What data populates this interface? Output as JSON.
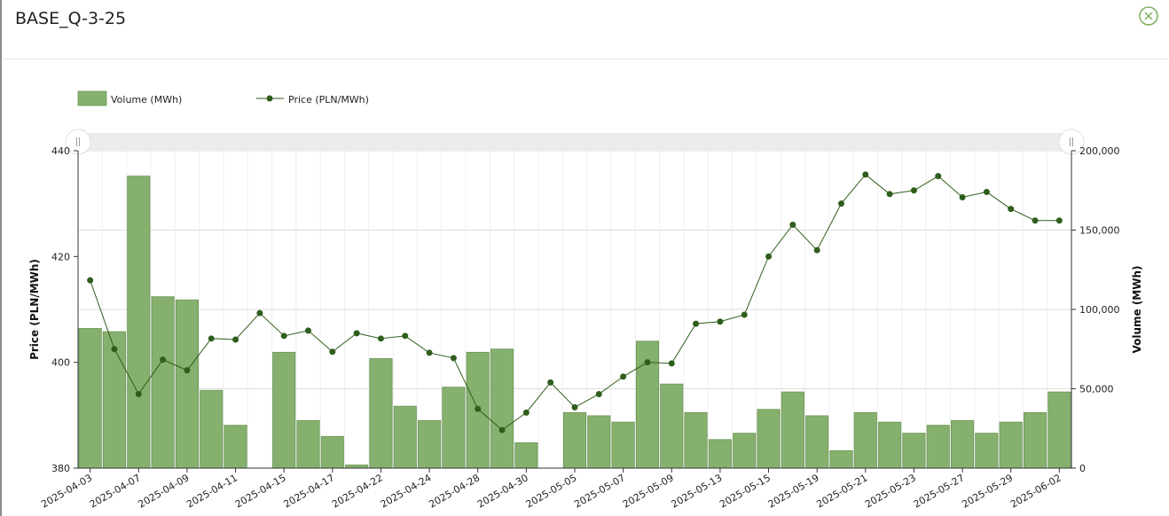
{
  "window": {
    "title": "BASE_Q-3-25",
    "close_icon": "close-circle-icon"
  },
  "colors": {
    "bar_fill": "#86b06e",
    "bar_stroke": "#6a9654",
    "line": "#2f5e1c",
    "point": "#2f5e1c",
    "grid": "#e6e6e6",
    "close": "#7fae5f"
  },
  "chart_data": {
    "type": "bar",
    "legend": [
      {
        "name": "Volume (MWh)",
        "kind": "bar"
      },
      {
        "name": "Price (PLN/MWh)",
        "kind": "line"
      }
    ],
    "legend_position": "top-left",
    "ylabel_left": "Price (PLN/MWh)",
    "ylabel_right": "Volume (MWh)",
    "ylim_left": [
      380,
      440
    ],
    "ylim_right": [
      0,
      200000
    ],
    "left_ticks": [
      "380",
      "400",
      "420",
      "440"
    ],
    "right_ticks": [
      "0",
      "50,000",
      "100,000",
      "150,000",
      "200,000"
    ],
    "x_tick_labels": [
      "2025-04-03",
      "2025-04-07",
      "2025-04-09",
      "2025-04-11",
      "2025-04-15",
      "2025-04-17",
      "2025-04-22",
      "2025-04-24",
      "2025-04-28",
      "2025-04-30",
      "2025-05-05",
      "2025-05-07",
      "2025-05-09",
      "2025-05-13",
      "2025-05-15",
      "2025-05-19",
      "2025-05-21",
      "2025-05-23",
      "2025-05-27",
      "2025-05-29",
      "2025-06-02"
    ],
    "x": [
      "2025-04-03",
      "2025-04-04",
      "2025-04-07",
      "2025-04-08",
      "2025-04-09",
      "2025-04-10",
      "2025-04-11",
      "2025-04-14",
      "2025-04-15",
      "2025-04-16",
      "2025-04-17",
      "2025-04-18",
      "2025-04-22",
      "2025-04-23",
      "2025-04-24",
      "2025-04-25",
      "2025-04-28",
      "2025-04-29",
      "2025-04-30",
      "2025-05-02",
      "2025-05-05",
      "2025-05-06",
      "2025-05-07",
      "2025-05-08",
      "2025-05-09",
      "2025-05-12",
      "2025-05-13",
      "2025-05-14",
      "2025-05-15",
      "2025-05-16",
      "2025-05-19",
      "2025-05-20",
      "2025-05-21",
      "2025-05-22",
      "2025-05-23",
      "2025-05-26",
      "2025-05-27",
      "2025-05-28",
      "2025-05-29",
      "2025-05-30",
      "2025-06-02"
    ],
    "series": [
      {
        "name": "Volume (MWh)",
        "type": "bar",
        "axis": "right",
        "values": [
          88000,
          86000,
          184000,
          108000,
          106000,
          49000,
          27000,
          null,
          73000,
          30000,
          20000,
          2000,
          69000,
          39000,
          30000,
          51000,
          73000,
          75000,
          16000,
          null,
          35000,
          33000,
          29000,
          80000,
          53000,
          35000,
          18000,
          22000,
          37000,
          48000,
          33000,
          11000,
          35000,
          29000,
          22000,
          27000,
          30000,
          22000,
          29000,
          35000,
          48000
        ]
      },
      {
        "name": "Price (PLN/MWh)",
        "type": "line",
        "axis": "left",
        "values": [
          415.5,
          402.5,
          394.0,
          400.5,
          398.5,
          404.5,
          404.3,
          409.3,
          405.0,
          406.0,
          402.0,
          405.5,
          404.5,
          405.0,
          401.8,
          400.8,
          391.2,
          387.2,
          390.5,
          396.2,
          391.5,
          394.0,
          397.3,
          400.0,
          399.8,
          407.3,
          407.7,
          409.0,
          420.0,
          426.0,
          421.2,
          430.0,
          435.5,
          431.8,
          432.5,
          435.2,
          431.2,
          432.2,
          429.0,
          426.8,
          426.8
        ]
      }
    ]
  }
}
